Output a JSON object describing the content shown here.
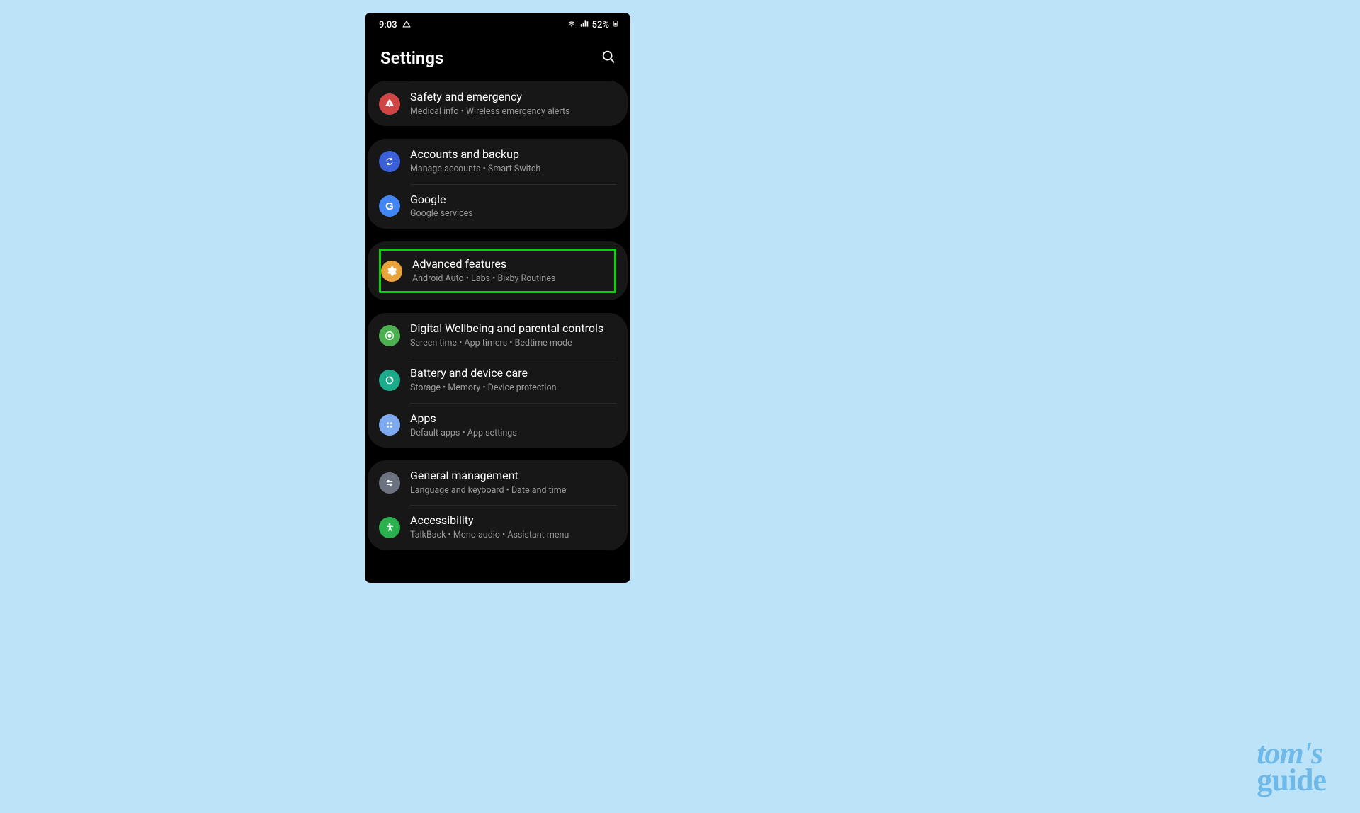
{
  "statusBar": {
    "time": "9:03",
    "battery": "52%"
  },
  "header": {
    "title": "Settings"
  },
  "groups": [
    {
      "items": [
        {
          "id": "safety",
          "title": "Safety and emergency",
          "subtitle": "Medical info  •  Wireless emergency alerts",
          "iconClass": "icon-bg-red",
          "iconName": "alert-icon"
        }
      ]
    },
    {
      "items": [
        {
          "id": "accounts",
          "title": "Accounts and backup",
          "subtitle": "Manage accounts  •  Smart Switch",
          "iconClass": "icon-bg-blue",
          "iconName": "sync-icon"
        },
        {
          "id": "google",
          "title": "Google",
          "subtitle": "Google services",
          "iconClass": "icon-bg-google",
          "iconName": "google-icon",
          "iconLetter": "G"
        }
      ]
    },
    {
      "items": [
        {
          "id": "advanced",
          "title": "Advanced features",
          "subtitle": "Android Auto  •  Labs  •  Bixby Routines",
          "iconClass": "icon-bg-orange",
          "iconName": "gear-icon",
          "highlighted": true
        }
      ]
    },
    {
      "items": [
        {
          "id": "wellbeing",
          "title": "Digital Wellbeing and parental controls",
          "subtitle": "Screen time  •  App timers  •  Bedtime mode",
          "iconClass": "icon-bg-green1",
          "iconName": "wellbeing-icon"
        },
        {
          "id": "battery",
          "title": "Battery and device care",
          "subtitle": "Storage  •  Memory  •  Device protection",
          "iconClass": "icon-bg-teal",
          "iconName": "device-care-icon"
        },
        {
          "id": "apps",
          "title": "Apps",
          "subtitle": "Default apps  •  App settings",
          "iconClass": "icon-bg-lightblue",
          "iconName": "apps-icon"
        }
      ]
    },
    {
      "items": [
        {
          "id": "general",
          "title": "General management",
          "subtitle": "Language and keyboard  •  Date and time",
          "iconClass": "icon-bg-grey",
          "iconName": "sliders-icon"
        },
        {
          "id": "accessibility",
          "title": "Accessibility",
          "subtitle": "TalkBack  •  Mono audio  •  Assistant menu",
          "iconClass": "icon-bg-access",
          "iconName": "accessibility-icon"
        }
      ]
    }
  ],
  "watermark": {
    "line1": "tom's",
    "line2": "guide"
  }
}
